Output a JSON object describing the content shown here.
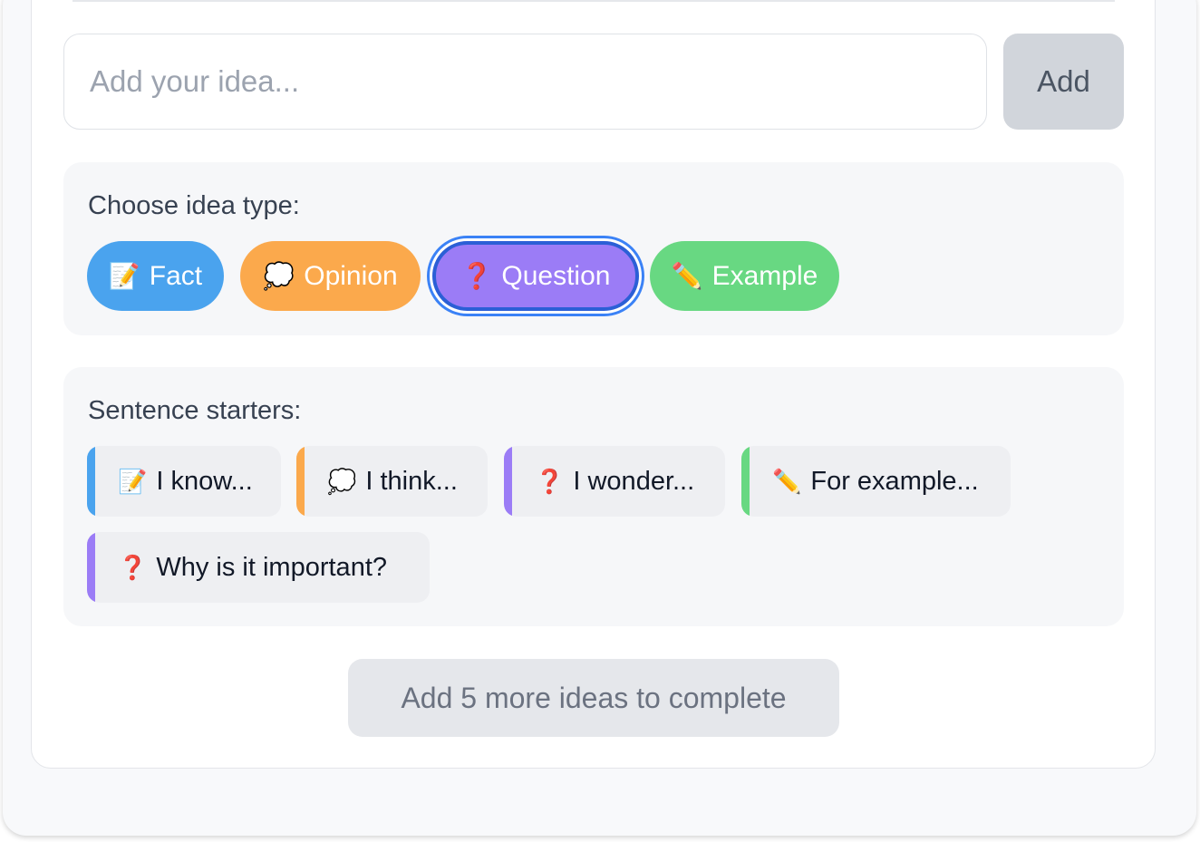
{
  "composer": {
    "input_placeholder": "Add your idea...",
    "input_value": "",
    "add_label": "Add"
  },
  "idea_types": {
    "label": "Choose idea type:",
    "selected": "Question",
    "options": [
      {
        "icon": "📝",
        "icon_name": "memo-icon",
        "label": "Fact",
        "color": "#4aa3ee"
      },
      {
        "icon": "💭",
        "icon_name": "thought-bubble-icon",
        "label": "Opinion",
        "color": "#fba94c"
      },
      {
        "icon": "❓",
        "icon_name": "question-mark-icon",
        "label": "Question",
        "color": "#9b7cf6"
      },
      {
        "icon": "✏️",
        "icon_name": "pencil-icon",
        "label": "Example",
        "color": "#68d882"
      }
    ]
  },
  "starters": {
    "label": "Sentence starters:",
    "items": [
      {
        "icon": "📝",
        "icon_name": "memo-icon",
        "text": "I know...",
        "color": "#4aa3ee"
      },
      {
        "icon": "💭",
        "icon_name": "thought-bubble-icon",
        "text": "I think...",
        "color": "#fba94c"
      },
      {
        "icon": "❓",
        "icon_name": "question-mark-icon",
        "text": "I wonder...",
        "color": "#9b7cf6"
      },
      {
        "icon": "✏️",
        "icon_name": "pencil-icon",
        "text": "For example...",
        "color": "#68d882"
      },
      {
        "icon": "❓",
        "icon_name": "question-mark-icon",
        "text": "Why is it important?",
        "color": "#9b7cf6"
      }
    ]
  },
  "complete_button": {
    "label": "Add 5 more ideas to complete"
  }
}
